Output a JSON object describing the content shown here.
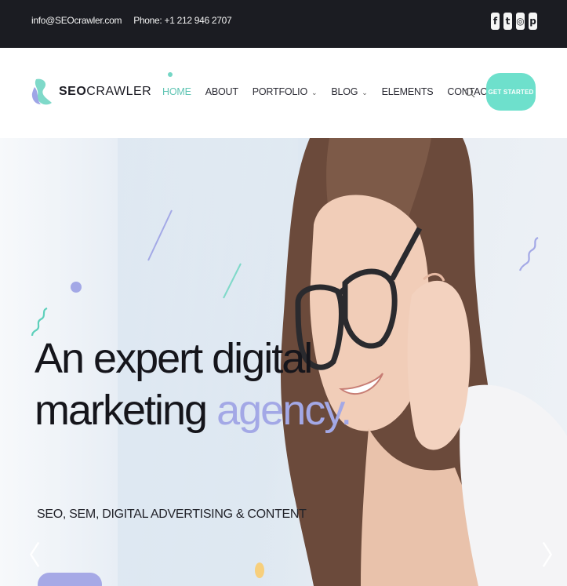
{
  "topbar": {
    "email": "info@SEOcrawler.com",
    "phone": "Phone: +1 212 946 2707",
    "social": [
      {
        "icon": "facebook-icon",
        "glyph": "f"
      },
      {
        "icon": "twitter-icon",
        "glyph": "t"
      },
      {
        "icon": "instagram-icon",
        "glyph": "◎"
      },
      {
        "icon": "pinterest-icon",
        "glyph": "p"
      }
    ]
  },
  "header": {
    "logo_bold": "SEO",
    "logo_rest": "CRAWLER",
    "nav": [
      {
        "label": "HOME",
        "active": true,
        "dropdown": false
      },
      {
        "label": "ABOUT",
        "active": false,
        "dropdown": false
      },
      {
        "label": "PORTFOLIO",
        "active": false,
        "dropdown": true
      },
      {
        "label": "BLOG",
        "active": false,
        "dropdown": true
      },
      {
        "label": "ELEMENTS",
        "active": false,
        "dropdown": false
      },
      {
        "label": "CONTACT",
        "active": false,
        "dropdown": false
      }
    ],
    "chevron": "⌄",
    "cta_label": "GET STARTED"
  },
  "hero": {
    "headline_line1": "An expert digital",
    "headline_line2_main": "marketing ",
    "headline_line2_accent": "agency.",
    "subline": "SEO, SEM, DIGITAL ADVERTISING & CONTENT",
    "prev_arrow": "〈",
    "next_arrow": "〉"
  },
  "colors": {
    "topbar_bg": "#1b1c22",
    "accent_teal": "#6ee0cc",
    "accent_purple": "#a3a8e6",
    "active_nav": "#5fc4b3"
  }
}
